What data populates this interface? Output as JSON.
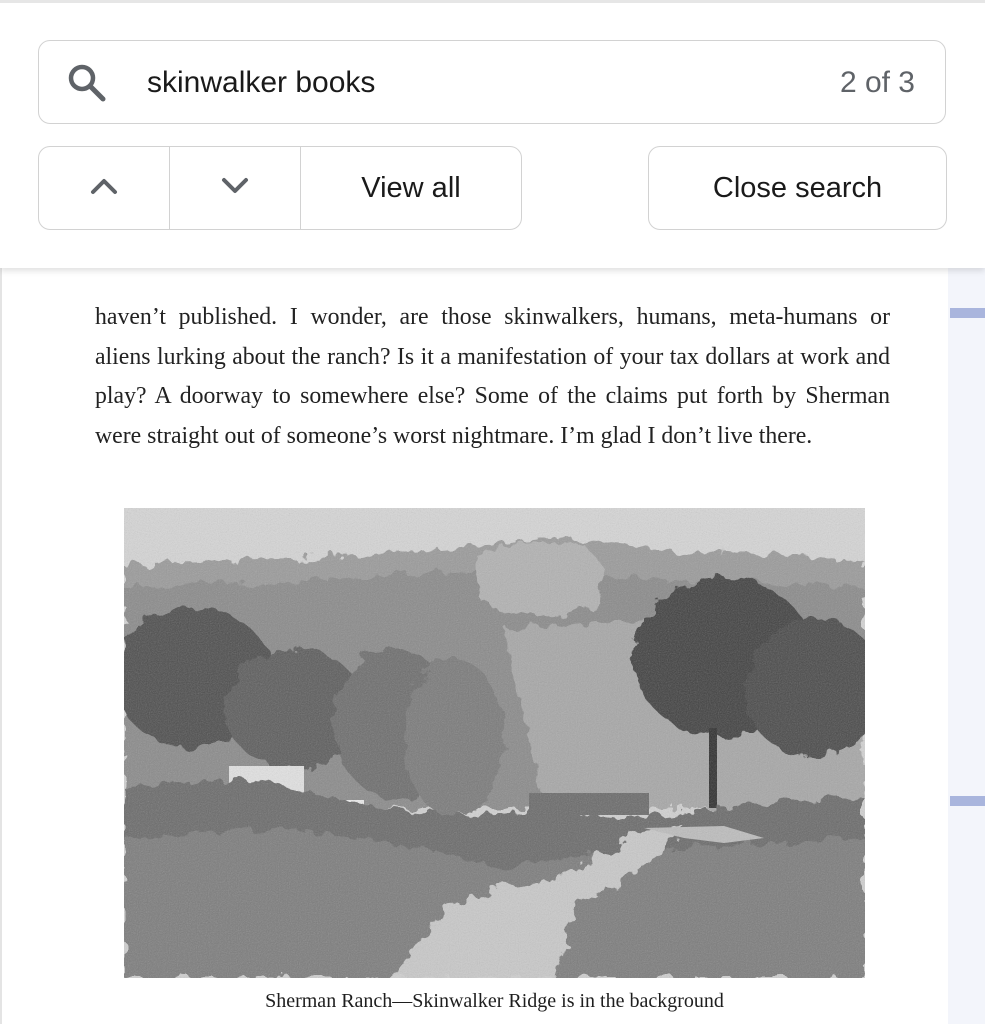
{
  "search": {
    "query": "skinwalker books",
    "match_count": "2 of 3",
    "icon": "search-icon"
  },
  "nav": {
    "prev_icon": "chevron-up-icon",
    "next_icon": "chevron-down-icon",
    "view_all_label": "View all",
    "close_label": "Close search"
  },
  "page": {
    "paragraph": "haven’t published. I wonder, are those skinwalkers, humans, meta-humans or aliens lurking about the ranch? Is it a manifestation of your tax dollars at work and play? A doorway to somewhere else? Some of the claims put forth by Sherman were straight out of someone’s worst nightmare. I’m glad I don’t live there.",
    "caption": "Sherman Ranch—Skinwalker Ridge is in the background"
  },
  "colors": {
    "border": "#d2d2d2",
    "count_text": "#5f6368",
    "scroll_marker": "#a9b5dd"
  }
}
